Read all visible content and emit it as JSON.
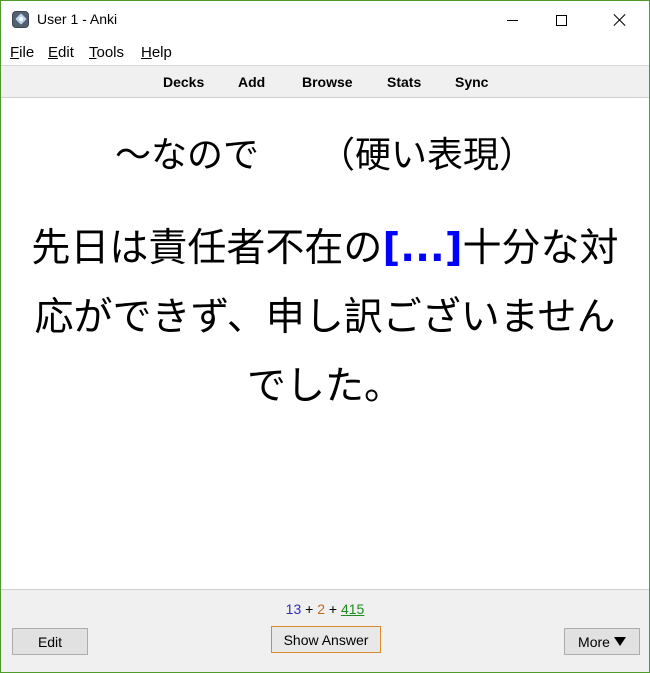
{
  "window": {
    "title": "User 1 - Anki",
    "icon": "anki-icon",
    "controls": {
      "minimize": "minimize-icon",
      "maximize": "maximize-icon",
      "close": "close-icon"
    }
  },
  "menu": {
    "items": [
      {
        "mnemonic": "F",
        "rest": "ile"
      },
      {
        "mnemonic": "E",
        "rest": "dit"
      },
      {
        "mnemonic": "T",
        "rest": "ools"
      },
      {
        "mnemonic": "H",
        "rest": "elp"
      }
    ]
  },
  "toolbar": {
    "items": [
      "Decks",
      "Add",
      "Browse",
      "Stats",
      "Sync"
    ]
  },
  "card": {
    "heading_left": "～なので",
    "heading_right": "（硬い表現）",
    "body_before": "先日は責任者不在の",
    "cloze": "[...]",
    "body_after": "十分な対応ができず、申し訳ございませんでした。",
    "cloze_color": "#0000ff"
  },
  "counts": {
    "new": "13",
    "learning": "2",
    "review": "415",
    "plus": "+",
    "colors": {
      "new": "#2f2fbf",
      "learning": "#c26b1d",
      "review": "#1f8a1f"
    }
  },
  "buttons": {
    "edit": "Edit",
    "show_answer": "Show Answer",
    "more": "More"
  }
}
